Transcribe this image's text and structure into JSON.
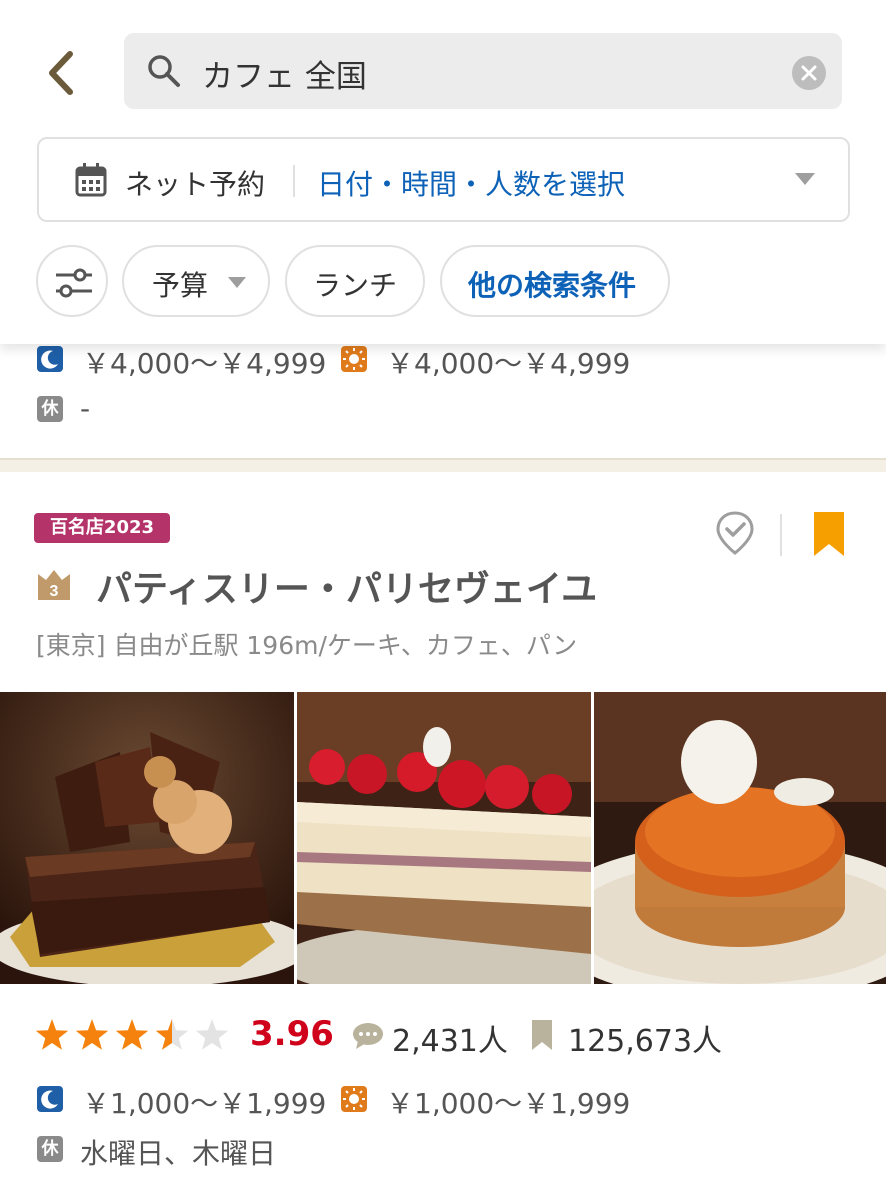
{
  "search": {
    "query": "カフェ 全国"
  },
  "reservation": {
    "label": "ネット予約",
    "selector": "日付・時間・人数を選択"
  },
  "filters": {
    "budget": "予算",
    "lunch": "ランチ",
    "other": "他の検索条件"
  },
  "previous": {
    "dinner_price": "￥4,000～￥4,999",
    "lunch_price": "￥4,000～￥4,999",
    "holiday_icon": "休",
    "holiday": "-"
  },
  "listing": {
    "badge": "百名店2023",
    "rank": "3",
    "name": "パティスリー・パリセヴェイユ",
    "area": "[東京] 自由が丘駅 196m/ケーキ、カフェ、パン",
    "rating": 3.96,
    "rating_text": "3.96",
    "reviews": "2,431人",
    "saves": "125,673人",
    "dinner_price": "￥1,000～￥1,999",
    "lunch_price": "￥1,000～￥1,999",
    "holiday_icon": "休",
    "holiday": "水曜日、木曜日"
  },
  "colors": {
    "accent_blue": "#0d62b8",
    "score_red": "#d0021b",
    "star_orange": "#f5820c",
    "badge": "#b4346a",
    "bookmark": "#f5a000",
    "back_arrow": "#6b5b3a"
  }
}
